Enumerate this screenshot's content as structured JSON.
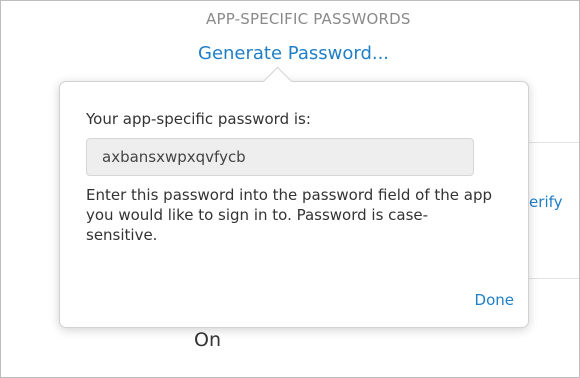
{
  "header": {
    "section_title": "APP-SPECIFIC PASSWORDS",
    "generate_link": "Generate Password..."
  },
  "background": {
    "verify_label_partial": "/erify",
    "toggle_value": "On"
  },
  "popover": {
    "label": "Your app-specific password is:",
    "password": "axbansxwpxqvfycb",
    "instructions": "Enter this password into the password field of the app you would like to sign in to. Password is case-sensitive.",
    "done_label": "Done"
  },
  "colors": {
    "link_blue": "#1f7fc7",
    "heading_gray": "#8a8a8a",
    "field_bg": "#eeeeee"
  }
}
